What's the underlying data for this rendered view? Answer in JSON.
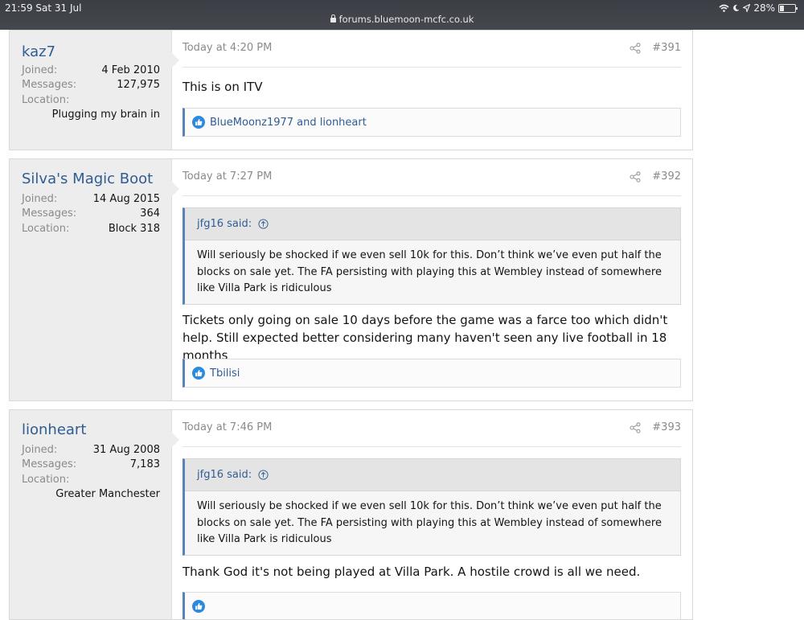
{
  "status_bar": {
    "time_date": "21:59  Sat 31 Jul",
    "url": "forums.bluemoon-mcfc.co.uk",
    "battery": "28%",
    "battery_level": 0.28
  },
  "posts": [
    {
      "username": "kaz7",
      "joined_label": "Joined:",
      "joined": "4 Feb 2010",
      "messages_label": "Messages:",
      "messages": "127,975",
      "location_label": "Location:",
      "location": "Plugging my brain in",
      "date": "Today at 4:20 PM",
      "number": "#391",
      "message": "This is on ITV",
      "reactions": "BlueMoonz1977 and lionheart"
    },
    {
      "username": "Silva's Magic Boot",
      "joined_label": "Joined:",
      "joined": "14 Aug 2015",
      "messages_label": "Messages:",
      "messages": "364",
      "location_label": "Location:",
      "location": "Block 318",
      "date": "Today at 7:27 PM",
      "number": "#392",
      "quote_author": "jfg16 said:",
      "quote_text": "Will seriously be shocked if we even sell 10k for this. Don’t think we’ve even put half the blocks on sale yet. The FA persisting with playing this at Wembley instead of somewhere like Villa Park is ridiculous",
      "message": "Tickets only going on sale 10 days before the game was a farce too which didn't help. Still expected better considering many haven't seen any live football in 18 months",
      "reactions": "Tbilisi"
    },
    {
      "username": "lionheart",
      "joined_label": "Joined:",
      "joined": "31 Aug 2008",
      "messages_label": "Messages:",
      "messages": "7,183",
      "location_label": "Location:",
      "location": "Greater Manchester",
      "date": "Today at 7:46 PM",
      "number": "#393",
      "quote_author": "jfg16 said:",
      "quote_text": "Will seriously be shocked if we even sell 10k for this. Don’t think we’ve even put half the blocks on sale yet. The FA persisting with playing this at Wembley instead of somewhere like Villa Park is ridiculous",
      "message": "Thank God it's not being played at Villa Park. A hostile crowd is all we need."
    }
  ],
  "colors": {
    "link": "#2f5c93",
    "quote_bar": "#5883b8",
    "like": "#2a8ae0",
    "user_panel": "#ededed"
  }
}
